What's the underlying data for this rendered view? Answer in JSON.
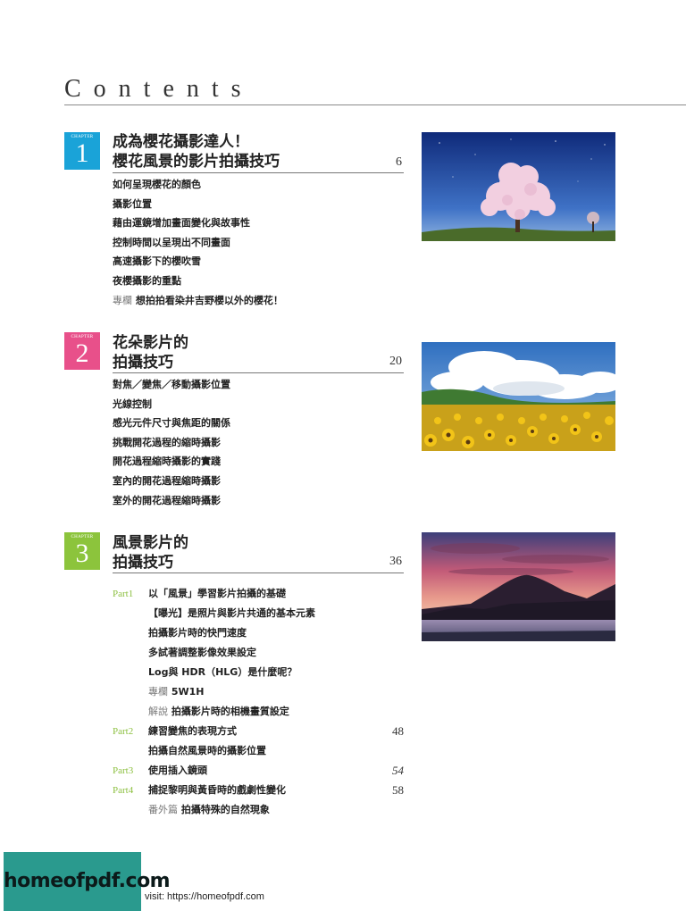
{
  "page": {
    "title": "Contents"
  },
  "chapters": [
    {
      "cap": "CHAPTER",
      "num": "1",
      "color": "#1aa3d8",
      "title_lines": [
        "成為櫻花攝影達人！",
        "櫻花風景的影片拍攝技巧"
      ],
      "page": "6",
      "items": [
        {
          "prefix": "",
          "text": "如何呈現櫻花的顏色"
        },
        {
          "prefix": "",
          "text": "攝影位置"
        },
        {
          "prefix": "",
          "text": "藉由運鏡增加畫面變化與故事性"
        },
        {
          "prefix": "",
          "text": "控制時間以呈現出不同畫面"
        },
        {
          "prefix": "",
          "text": "高速攝影下的櫻吹雪"
        },
        {
          "prefix": "",
          "text": "夜櫻攝影的重點"
        },
        {
          "prefix": "專欄",
          "text": "想拍拍看染井吉野櫻以外的櫻花！"
        }
      ],
      "photo": "cherry-blossom-night-sky-photo"
    },
    {
      "cap": "CHAPTER",
      "num": "2",
      "color": "#e8508a",
      "title_lines": [
        "花朵影片的",
        "拍攝技巧"
      ],
      "page": "20",
      "items": [
        {
          "prefix": "",
          "text": "對焦／變焦／移動攝影位置"
        },
        {
          "prefix": "",
          "text": "光線控制"
        },
        {
          "prefix": "",
          "text": "感光元件尺寸與焦距的關係"
        },
        {
          "prefix": "",
          "text": "挑戰開花過程的縮時攝影"
        },
        {
          "prefix": "",
          "text": "開花過程縮時攝影的實踐"
        },
        {
          "prefix": "",
          "text": "室內的開花過程縮時攝影"
        },
        {
          "prefix": "",
          "text": "室外的開花過程縮時攝影"
        }
      ],
      "photo": "sunflower-field-photo"
    },
    {
      "cap": "CHAPTER",
      "num": "3",
      "color": "#8cc43c",
      "title_lines": [
        "風景影片的",
        "拍攝技巧"
      ],
      "page": "36",
      "rows": [
        {
          "part": "Part1",
          "prefix": "",
          "text": "以「風景」學習影片拍攝的基礎",
          "page": ""
        },
        {
          "part": "",
          "prefix": "",
          "text": "【曝光】是照片與影片共通的基本元素",
          "page": ""
        },
        {
          "part": "",
          "prefix": "",
          "text": "拍攝影片時的快門速度",
          "page": ""
        },
        {
          "part": "",
          "prefix": "",
          "text": "多試著調整影像效果設定",
          "page": ""
        },
        {
          "part": "",
          "prefix": "",
          "text": "Log與 HDR（HLG）是什麼呢？",
          "page": ""
        },
        {
          "part": "",
          "prefix": "專欄",
          "text": "5W1H",
          "page": ""
        },
        {
          "part": "",
          "prefix": "解說",
          "text": "拍攝影片時的相機畫質設定",
          "page": ""
        },
        {
          "part": "Part2",
          "prefix": "",
          "text": "練習變焦的表現方式",
          "page": "48"
        },
        {
          "part": "",
          "prefix": "",
          "text": "拍攝自然風景時的攝影位置",
          "page": ""
        },
        {
          "part": "Part3",
          "prefix": "",
          "text": "使用插入鏡頭",
          "page": "54"
        },
        {
          "part": "Part4",
          "prefix": "",
          "text": "捕捉黎明與黃昏時的戲劇性變化",
          "page": "58"
        },
        {
          "part": "",
          "prefix": "番外篇",
          "text": "拍攝特殊的自然現象",
          "page": ""
        }
      ],
      "photo": "mount-fuji-sunset-photo"
    }
  ],
  "footer": {
    "logo": "homeofpdf.com",
    "visit": "visit: https://homeofpdf.com"
  }
}
